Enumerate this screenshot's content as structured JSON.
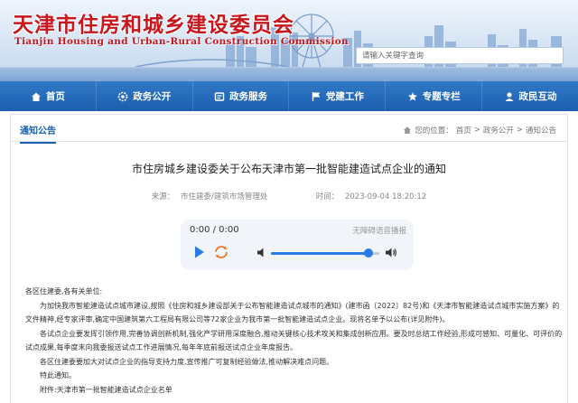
{
  "header": {
    "title": "天津市住房和城乡建设委员会",
    "subtitle": "Tianjin Housing and Urban-Rural Construction Commission",
    "search_placeholder": "请输入关键字查询"
  },
  "nav": {
    "items": [
      {
        "label": "首页",
        "icon": "home-icon"
      },
      {
        "label": "政务公开",
        "icon": "gear-icon"
      },
      {
        "label": "政务服务",
        "icon": "service-icon"
      },
      {
        "label": "党建工作",
        "icon": "flag-icon"
      },
      {
        "label": "专题专栏",
        "icon": "star-icon"
      },
      {
        "label": "政民互动",
        "icon": "user-icon"
      }
    ]
  },
  "section": {
    "tab_label": "通知公告",
    "breadcrumb": [
      "您的位置：",
      "首页",
      ">",
      "政务公开",
      ">",
      "通知公告"
    ]
  },
  "article": {
    "title": "市住房城乡建设委关于公布天津市第一批智能建造试点企业的通知",
    "source_label": "来源：",
    "source_value": "市住建委/建筑市场管理处",
    "time_label": "时间：",
    "time_value": "2023-09-04 18:20:12",
    "paragraphs": [
      "各区住建委,各有关单位:",
      "为加快我市智能建造试点城市建设,按照《住房和城乡建设部关于公布智能建造试点城市的通知》(建市函〔2022〕82号)和《天津市智能建造试点城市实施方案》的文件精神,经专家评审,确定中国建筑第六工程局有限公司等72家企业为我市第一批智能建造试点企业。现将名单予以公布(详见附件)。",
      "各试点企业要发挥引领作用,完善协调创新机制,强化产学研用深度融合,推动关键核心技术攻关和集成创新应用。要及时总结工作经验,形成可感知、可量化、可评价的试点成果,每季度末向我委报送试点工作进展情况,每年年底前报送试点企业年度报告。",
      "各区住建委要加大对试点企业的指导支持力度,宣传推广可复制经验做法,推动解决难点问题。",
      "特此通知。",
      "附件:天津市第一批智能建造试点企业名单"
    ]
  },
  "player": {
    "time": "0:00 / 0:00",
    "tts_label": "无障碍语音播报",
    "progress": 0.9
  },
  "colors": {
    "nav_blue": "#1b5fae",
    "title_red": "#c8161d",
    "accent": "#2a7be4"
  }
}
